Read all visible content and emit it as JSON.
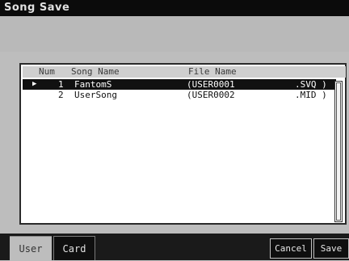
{
  "window": {
    "title": "Song Save"
  },
  "table": {
    "headers": {
      "num": "Num",
      "song_name": "Song Name",
      "file_name": "File Name"
    },
    "rows": [
      {
        "num": "1",
        "song_name": "FantomS",
        "file_prefix": "(USER0001",
        "file_ext": ".SVQ )",
        "selected": true,
        "marker": "▶"
      },
      {
        "num": "2",
        "song_name": "UserSong",
        "file_prefix": "(USER0002",
        "file_ext": ".MID )",
        "selected": false
      }
    ]
  },
  "tabs": [
    {
      "label": "User",
      "active": true
    },
    {
      "label": "Card",
      "active": false
    }
  ],
  "buttons": {
    "cancel": "Cancel",
    "save": "Save"
  }
}
